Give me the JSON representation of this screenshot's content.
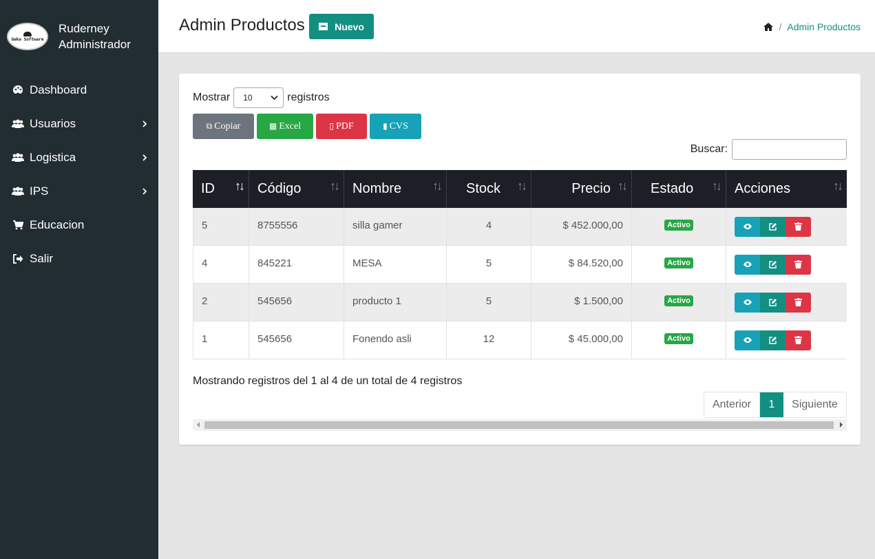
{
  "sidebar": {
    "logo_text": "Geko Software",
    "user_name": "Ruderney",
    "user_role": "Administrador",
    "items": [
      {
        "label": "Dashboard",
        "icon": "palette-icon",
        "has_children": false
      },
      {
        "label": "Usuarios",
        "icon": "users-icon",
        "has_children": true
      },
      {
        "label": "Logistica",
        "icon": "users-icon",
        "has_children": true
      },
      {
        "label": "IPS",
        "icon": "users-icon",
        "has_children": true
      },
      {
        "label": "Educacion",
        "icon": "cart-icon",
        "has_children": false
      },
      {
        "label": "Salir",
        "icon": "sign-out-icon",
        "has_children": false
      }
    ]
  },
  "header": {
    "title": "Admin Productos",
    "new_button": "Nuevo",
    "breadcrumb": {
      "current": "Admin Productos",
      "separator": "/"
    }
  },
  "table_controls": {
    "show_label": "Mostrar",
    "page_size": "10",
    "records_label": "registros",
    "export_buttons": {
      "copy": "Copiar",
      "excel": "Excel",
      "pdf": "PDF",
      "csv": "CVS"
    },
    "search_label": "Buscar:",
    "search_value": ""
  },
  "table": {
    "columns": [
      "ID",
      "Código",
      "Nombre",
      "Stock",
      "Precio",
      "Estado",
      "Acciones"
    ],
    "rows": [
      {
        "id": "5",
        "codigo": "8755556",
        "nombre": "silla gamer",
        "stock": "4",
        "precio": "$ 452.000,00",
        "estado": "Activo"
      },
      {
        "id": "4",
        "codigo": "845221",
        "nombre": "MESA",
        "stock": "5",
        "precio": "$ 84.520,00",
        "estado": "Activo"
      },
      {
        "id": "2",
        "codigo": "545656",
        "nombre": "producto 1",
        "stock": "5",
        "precio": "$ 1.500,00",
        "estado": "Activo"
      },
      {
        "id": "1",
        "codigo": "545656",
        "nombre": "Fonendo asli",
        "stock": "12",
        "precio": "$ 45.000,00",
        "estado": "Activo"
      }
    ]
  },
  "footer": {
    "info": "Mostrando registros del 1 al 4 de un total de 4 registros",
    "prev": "Anterior",
    "page": "1",
    "next": "Siguiente"
  },
  "colors": {
    "sidebar_bg": "#222d32",
    "accent": "#138f82",
    "table_header_bg": "#1c1f26",
    "success": "#28a745",
    "danger": "#dc3545",
    "info": "#17a2b8",
    "secondary": "#6c757d"
  }
}
